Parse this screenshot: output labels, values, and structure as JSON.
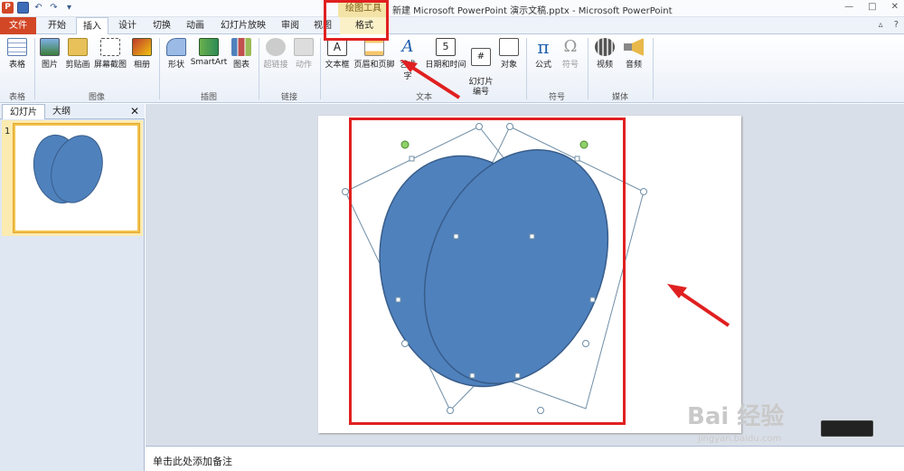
{
  "titlebar": {
    "doc_title": "新建 Microsoft PowerPoint 演示文稿.pptx - Microsoft PowerPoint",
    "context_tool": "绘图工具",
    "min": "—",
    "max": "□",
    "close": "✕"
  },
  "tabs": {
    "file": "文件",
    "home": "开始",
    "insert": "插入",
    "design": "设计",
    "transitions": "切换",
    "animations": "动画",
    "slideshow": "幻灯片放映",
    "review": "审阅",
    "view": "视图",
    "format": "格式"
  },
  "ribbon": {
    "table": "表格",
    "picture": "图片",
    "clipart": "剪贴画",
    "screenshot": "屏幕截图",
    "album": "相册",
    "shapes": "形状",
    "smartart": "SmartArt",
    "chart": "图表",
    "hyperlink": "超链接",
    "action": "动作",
    "textbox": "文本框",
    "header_footer": "页眉和页脚",
    "wordart": "艺术字",
    "datetime": "日期和时间",
    "slide_number": "幻灯片\n编号",
    "object": "对象",
    "equation": "公式",
    "symbol": "符号",
    "video": "视频",
    "audio": "音频",
    "groups": {
      "tables": "表格",
      "images": "图像",
      "illustrations": "插图",
      "links": "链接",
      "text": "文本",
      "symbols": "符号",
      "media": "媒体"
    }
  },
  "leftpanel": {
    "tab_slides": "幻灯片",
    "tab_outline": "大纲",
    "close": "✕",
    "slide_number": "1"
  },
  "notes": {
    "placeholder": "单击此处添加备注"
  },
  "watermark": {
    "brand": "Bai 经验",
    "url": "jingyan.baidu.com"
  },
  "colors": {
    "shape_fill": "#4f81bd",
    "shape_stroke": "#385d8a",
    "annotation": "#e02020",
    "file_tab": "#d24726"
  }
}
